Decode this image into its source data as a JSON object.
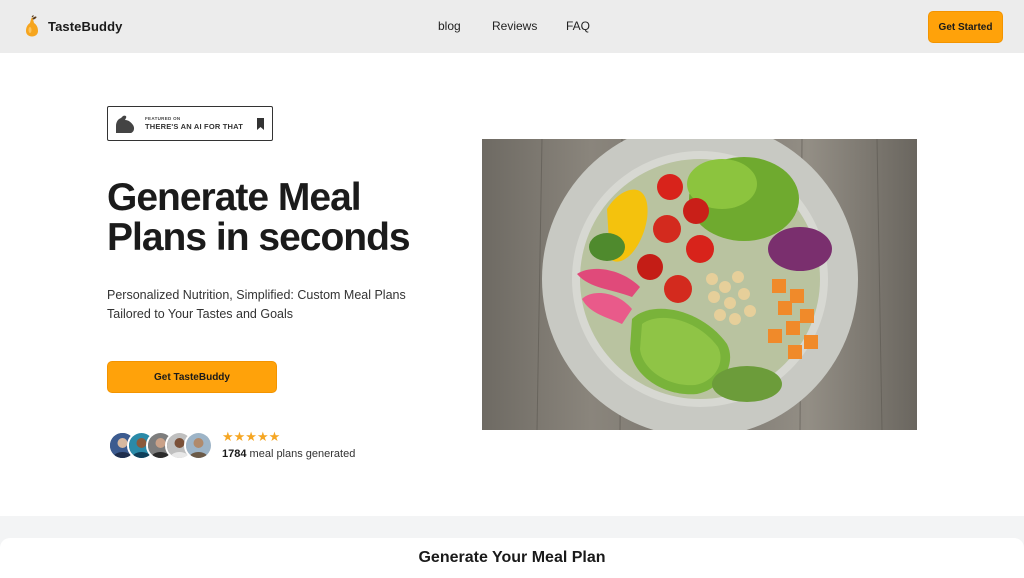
{
  "brand": {
    "name": "TasteBuddy"
  },
  "nav": {
    "links": [
      "blog",
      "Reviews",
      "FAQ"
    ],
    "cta_label": "Get Started"
  },
  "badge": {
    "small_text": "FEATURED ON",
    "big_text": "THERE'S AN AI FOR THAT"
  },
  "hero": {
    "headline_line1": "Generate Meal",
    "headline_line2": "Plans in seconds",
    "subtitle_line1": "Personalized Nutrition, Simplified: Custom Meal Plans",
    "subtitle_line2": "Tailored to Your Tastes and Goals",
    "cta_label": "Get TasteBuddy",
    "stars": "★★★★★",
    "count": "1784",
    "count_suffix": " meal plans generated",
    "image_icon": "salad-bowl-photo"
  },
  "section": {
    "title": "Generate Your Meal Plan"
  },
  "colors": {
    "accent": "#ffa20a",
    "nav_bg": "#ececec",
    "star": "#f5a623"
  }
}
